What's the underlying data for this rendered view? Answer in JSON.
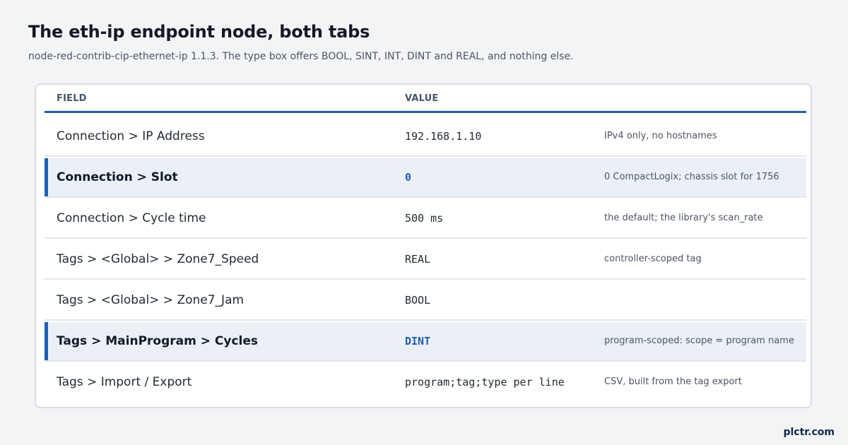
{
  "header": {
    "title": "The eth-ip endpoint node, both tabs",
    "subtitle": "node-red-contrib-cip-ethernet-ip 1.1.3. The type box offers BOOL, SINT, INT, DINT and REAL, and nothing else."
  },
  "table": {
    "columns": {
      "field": "FIELD",
      "value": "VALUE"
    },
    "rows": [
      {
        "field": "Connection > IP Address",
        "value": "192.168.1.10",
        "note": "IPv4 only, no hostnames",
        "highlight": false
      },
      {
        "field": "Connection > Slot",
        "value": "0",
        "note": "0 CompactLogix; chassis slot for 1756",
        "highlight": true
      },
      {
        "field": "Connection > Cycle time",
        "value": "500 ms",
        "note": "the default; the library's scan_rate",
        "highlight": false
      },
      {
        "field": "Tags > <Global> > Zone7_Speed",
        "value": "REAL",
        "note": "controller-scoped tag",
        "highlight": false
      },
      {
        "field": "Tags > <Global> > Zone7_Jam",
        "value": "BOOL",
        "note": "",
        "highlight": false
      },
      {
        "field": "Tags > MainProgram > Cycles",
        "value": "DINT",
        "note": "program-scoped: scope = program name",
        "highlight": true
      },
      {
        "field": "Tags > Import / Export",
        "value": "program;tag;type per line",
        "note": "CSV, built from the tag export",
        "highlight": false
      }
    ]
  },
  "footer": {
    "brand": "plctr.com"
  },
  "colors": {
    "accent": "#1e5fb0",
    "highlight_bg": "#ebf0f7",
    "page_bg": "#f3f4f6"
  }
}
